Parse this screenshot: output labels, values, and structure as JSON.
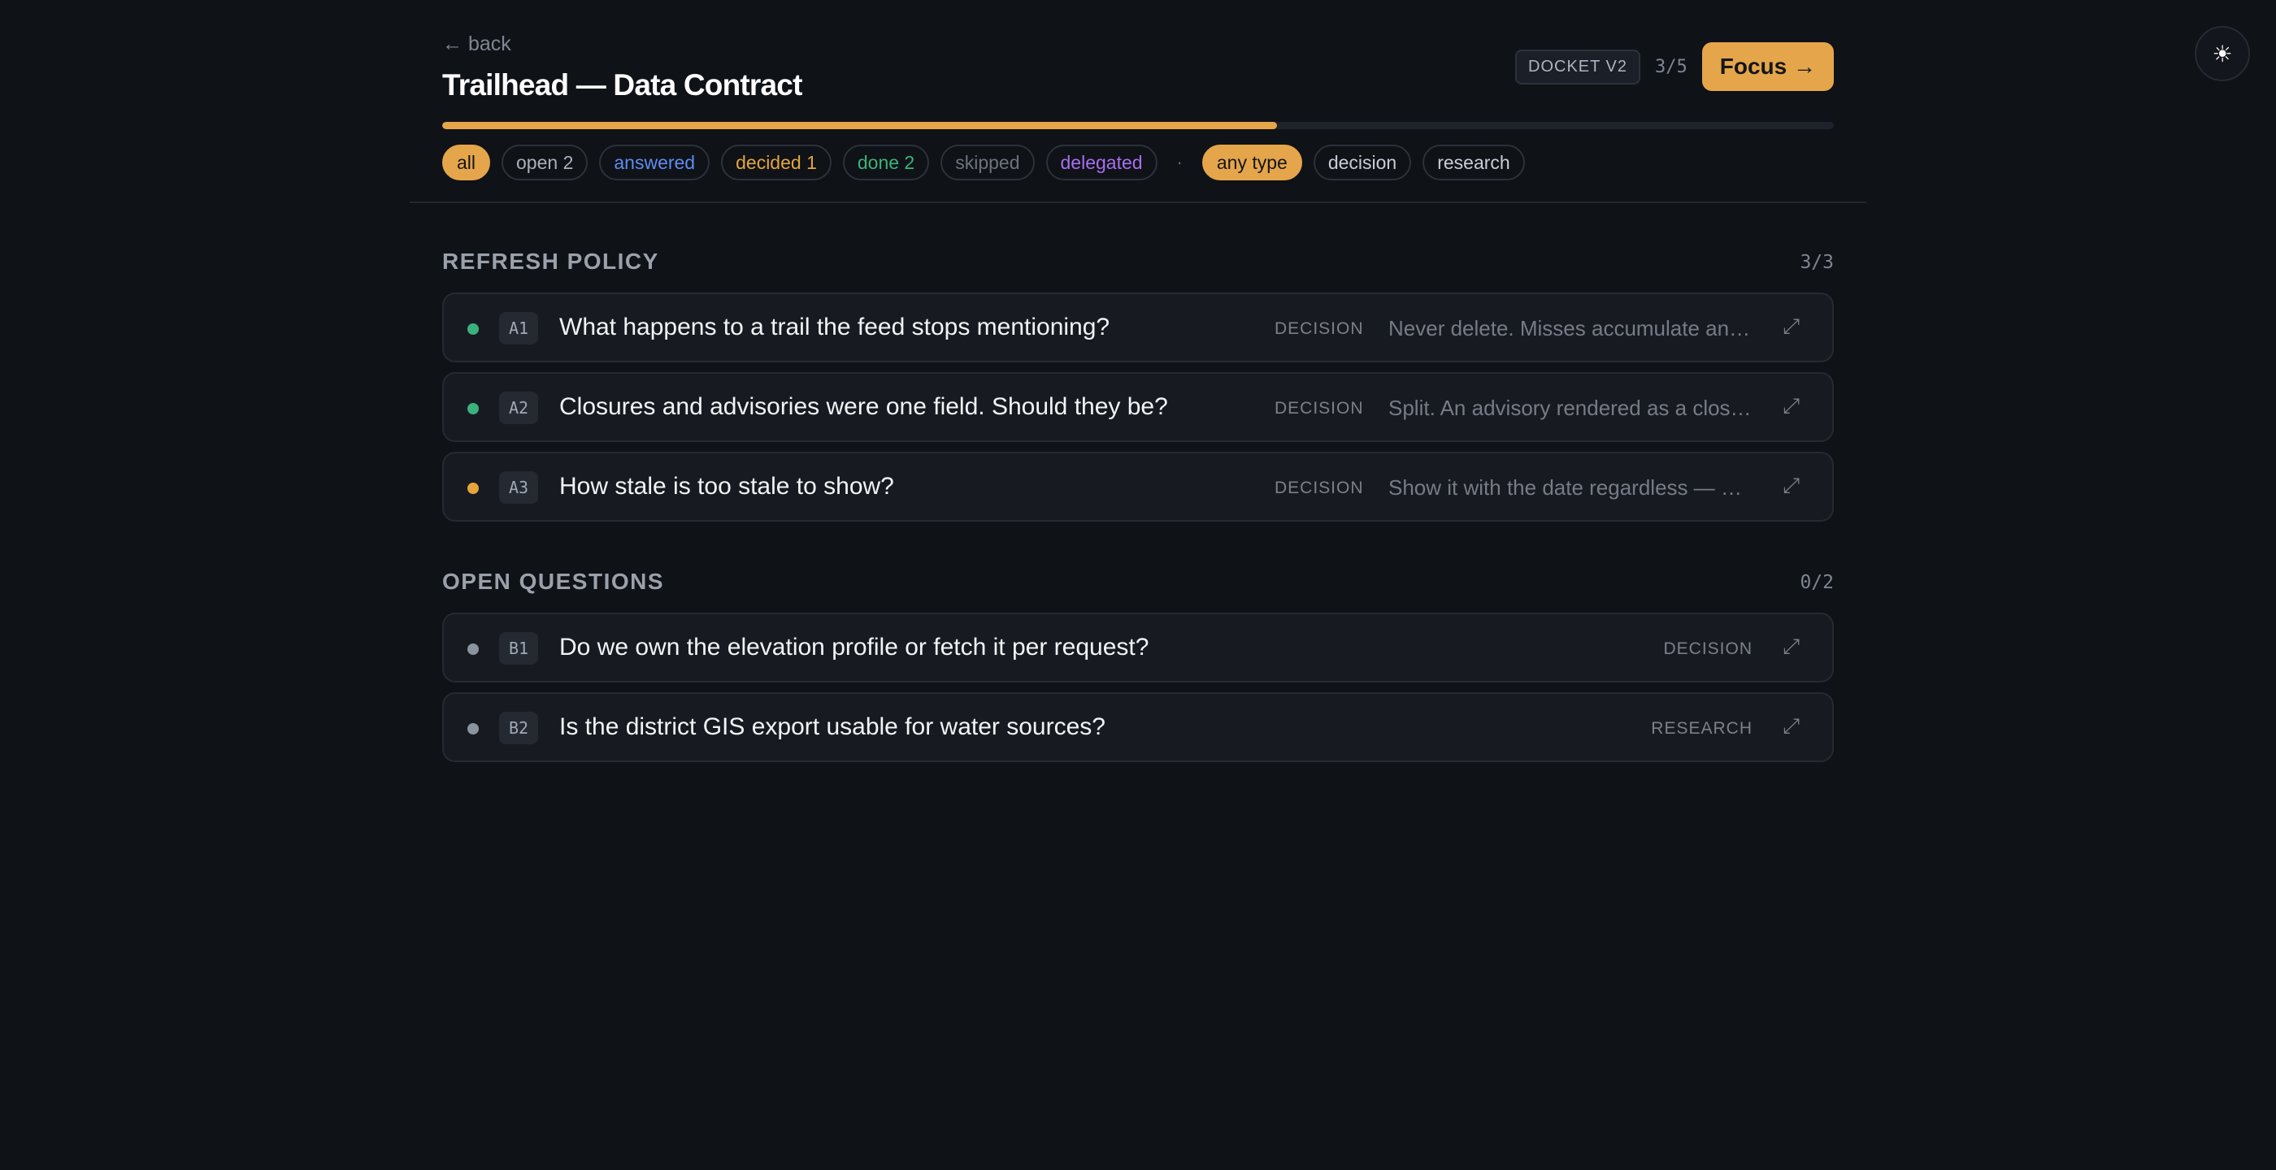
{
  "header": {
    "back_label": "← back",
    "title": "Trailhead — Data Contract",
    "docket_badge": "DOCKET V2",
    "progress_text": "3/5",
    "focus_label": "Focus →",
    "progress_fraction": 0.6
  },
  "theme_toggle": {
    "icon": "sun-icon",
    "glyph": "☀"
  },
  "filters": {
    "status": [
      {
        "label": "all",
        "active": true,
        "color": "#14161a"
      },
      {
        "label": "open 2",
        "active": false,
        "color": "#aab0b9"
      },
      {
        "label": "answered",
        "active": false,
        "color": "#5d8df0"
      },
      {
        "label": "decided 1",
        "active": false,
        "color": "#e3a53e"
      },
      {
        "label": "done 2",
        "active": false,
        "color": "#3bb27d"
      },
      {
        "label": "skipped",
        "active": false,
        "color": "#6c737d"
      },
      {
        "label": "delegated",
        "active": false,
        "color": "#a86ef0"
      }
    ],
    "separator": "·",
    "type": [
      {
        "label": "any type",
        "active": true,
        "color": "#14161a"
      },
      {
        "label": "decision",
        "active": false,
        "color": "#c9ced6"
      },
      {
        "label": "research",
        "active": false,
        "color": "#c9ced6"
      }
    ]
  },
  "sections": [
    {
      "title": "REFRESH POLICY",
      "count": "3/3",
      "items": [
        {
          "id": "A1",
          "status_color": "#3bb27d",
          "question": "What happens to a trail the feed stops mentioning?",
          "type": "DECISION",
          "answer": "Never delete. Misses accumulate and…"
        },
        {
          "id": "A2",
          "status_color": "#3bb27d",
          "question": "Closures and advisories were one field. Should they be?",
          "type": "DECISION",
          "answer": "Split. An advisory rendered as a clos…"
        },
        {
          "id": "A3",
          "status_color": "#e5a53b",
          "question": "How stale is too stale to show?",
          "type": "DECISION",
          "answer": "Show it with the date regardless — hi…"
        }
      ]
    },
    {
      "title": "OPEN QUESTIONS",
      "count": "0/2",
      "items": [
        {
          "id": "B1",
          "status_color": "#8c939e",
          "question": "Do we own the elevation profile or fetch it per request?",
          "type": "DECISION",
          "answer": ""
        },
        {
          "id": "B2",
          "status_color": "#8c939e",
          "question": "Is the district GIS export usable for water sources?",
          "type": "RESEARCH",
          "answer": ""
        }
      ]
    }
  ],
  "expand_icon": "expand-icon"
}
